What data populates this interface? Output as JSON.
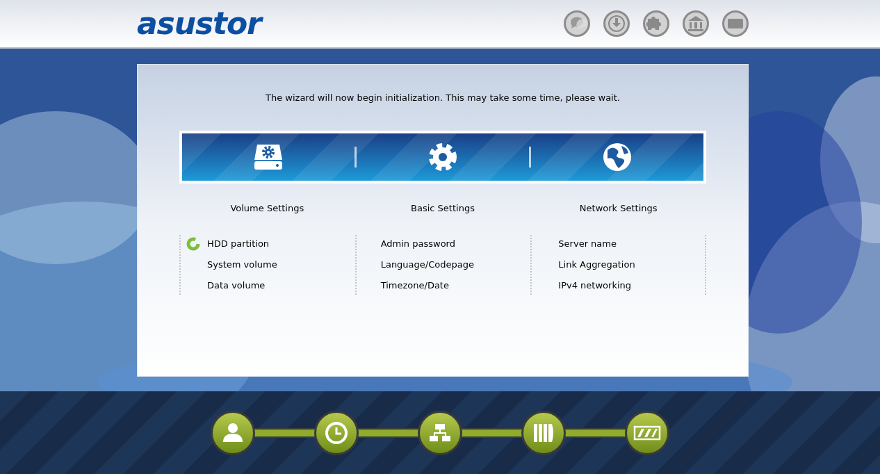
{
  "logo": "asustor",
  "message": "The wizard will now begin initialization. This may take some time, please wait.",
  "sections": [
    {
      "title": "Volume Settings",
      "items": [
        {
          "label": "HDD partition",
          "active": true
        },
        {
          "label": "System volume",
          "active": false
        },
        {
          "label": "Data volume",
          "active": false
        }
      ]
    },
    {
      "title": "Basic Settings",
      "items": [
        {
          "label": "Admin password",
          "active": false
        },
        {
          "label": "Language/Codepage",
          "active": false
        },
        {
          "label": "Timezone/Date",
          "active": false
        }
      ]
    },
    {
      "title": "Network Settings",
      "items": [
        {
          "label": "Server name",
          "active": false
        },
        {
          "label": "Link Aggregation",
          "active": false
        },
        {
          "label": "IPv4 networking",
          "active": false
        }
      ]
    }
  ]
}
